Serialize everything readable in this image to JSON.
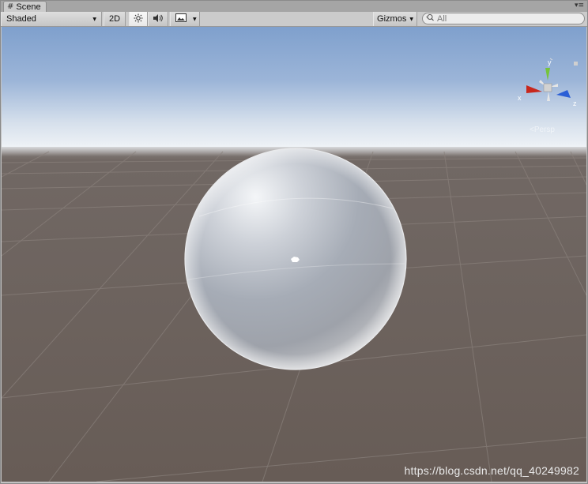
{
  "window": {
    "tab_title": "Scene",
    "tab_icon": "hash-icon",
    "menu_icon": "window-menu-icon"
  },
  "toolbar": {
    "shading_mode": "Shaded",
    "mode_2d_label": "2D",
    "lighting_icon": "sun-icon",
    "audio_icon": "speaker-icon",
    "effects_icon": "image-icon",
    "gizmos_label": "Gizmos",
    "search_placeholder": "All"
  },
  "scene": {
    "sky_top": "#7f9fcc",
    "sky_horizon": "#e6ecf4",
    "ground_color": "#6a605a",
    "object": "sphere"
  },
  "gizmo": {
    "x_label": "x",
    "y_label": "y",
    "z_label": "z",
    "x_color": "#c8271c",
    "y_color": "#76c43a",
    "z_color": "#2b5fd6",
    "projection_label": "<Persp"
  },
  "watermark": "https://blog.csdn.net/qq_40249982"
}
